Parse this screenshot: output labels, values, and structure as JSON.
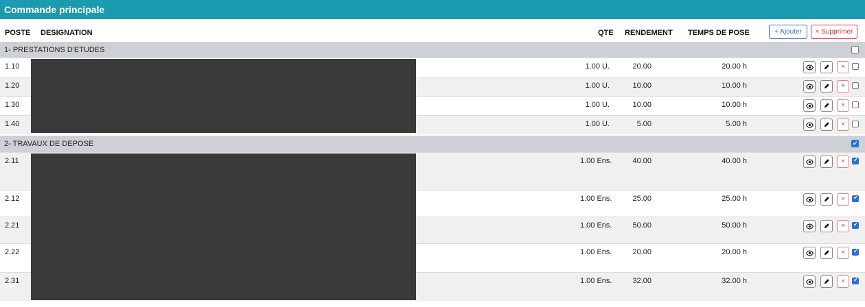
{
  "title": "Commande principale",
  "columns": {
    "poste": "POSTE",
    "designation": "DESIGNATION",
    "qte": "QTE",
    "rendement": "RENDEMENT",
    "temps": "TEMPS DE POSE"
  },
  "buttons": {
    "ajouter": "+ Ajouter",
    "supprimer": "× Supprimer"
  },
  "groups": [
    {
      "label": "1- PRESTATIONS D'ETUDES",
      "checked": false,
      "rows": [
        {
          "poste": "1.10",
          "qte": "1.00 U.",
          "rendement": "20.00",
          "temps": "20.00 h",
          "checked": false
        },
        {
          "poste": "1.20",
          "qte": "1.00 U.",
          "rendement": "10.00",
          "temps": "10.00 h",
          "checked": false
        },
        {
          "poste": "1.30",
          "qte": "1.00 U.",
          "rendement": "10.00",
          "temps": "10.00 h",
          "checked": false
        },
        {
          "poste": "1.40",
          "qte": "1.00 U.",
          "rendement": "5.00",
          "temps": "5.00 h",
          "checked": false
        }
      ]
    },
    {
      "label": "2- TRAVAUX DE DEPOSE",
      "checked": true,
      "rows": [
        {
          "poste": "2.11",
          "qte": "1.00 Ens.",
          "rendement": "40.00",
          "temps": "40.00 h",
          "checked": true
        },
        {
          "poste": "2.12",
          "qte": "1.00 Ens.",
          "rendement": "25.00",
          "temps": "25.00 h",
          "checked": true
        },
        {
          "poste": "2.21",
          "qte": "1.00 Ens.",
          "rendement": "50.00",
          "temps": "50.00 h",
          "checked": true
        },
        {
          "poste": "2.22",
          "qte": "1.00 Ens.",
          "rendement": "20.00",
          "temps": "20.00 h",
          "checked": true
        },
        {
          "poste": "2.31",
          "qte": "1.00 Ens.",
          "rendement": "32.00",
          "temps": "32.00 h",
          "checked": true
        }
      ]
    }
  ],
  "icons": {
    "view": "eye-icon",
    "edit": "pencil-icon",
    "delete": "close-icon"
  },
  "colors": {
    "title_bar": "#1a9bb0",
    "group_bg": "#cdd0d4",
    "primary": "#2f6fd4",
    "danger": "#d9303e"
  }
}
